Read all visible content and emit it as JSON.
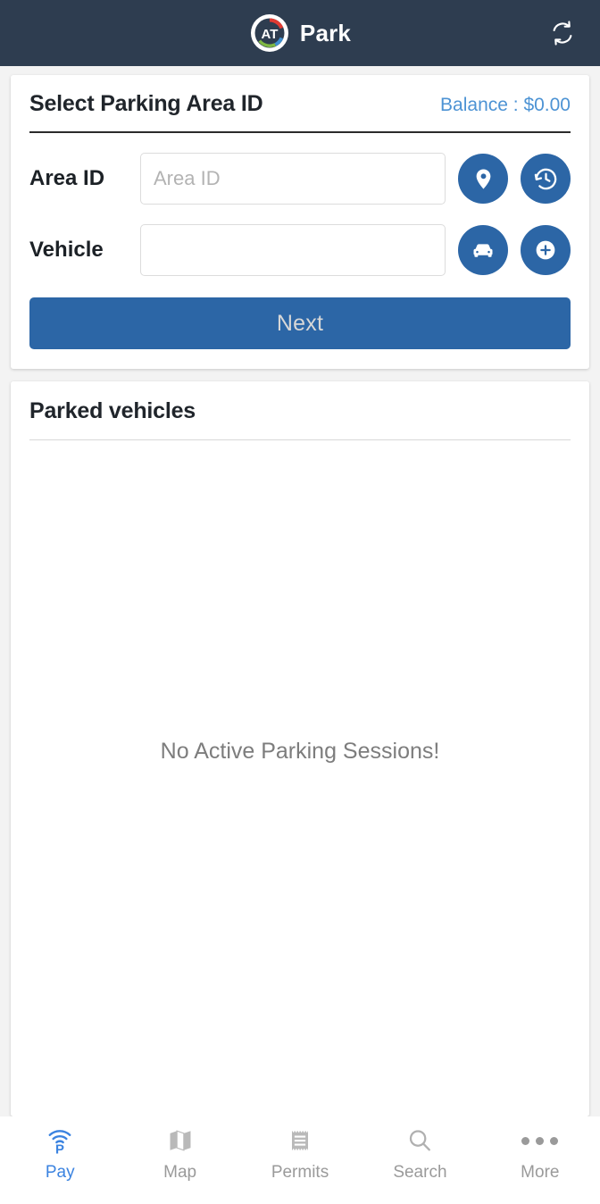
{
  "header": {
    "brand_name": "Park",
    "logo_text": "AT",
    "refresh_icon": "refresh-sync-icon",
    "bg_color": "#2e3d50"
  },
  "select_card": {
    "title": "Select Parking Area ID",
    "balance": "Balance : $0.00",
    "balance_color": "#4d93d4",
    "area": {
      "label": "Area ID",
      "value": "",
      "placeholder": "Area ID",
      "buttons": [
        {
          "name": "map-pin-icon",
          "title": "Find on map"
        },
        {
          "name": "history-clock-icon",
          "title": "Recent areas"
        }
      ]
    },
    "vehicle": {
      "label": "Vehicle",
      "value": "",
      "placeholder": "",
      "buttons": [
        {
          "name": "car-icon",
          "title": "Select vehicle"
        },
        {
          "name": "plus-circle-icon",
          "title": "Add vehicle"
        }
      ]
    },
    "next_label": "Next",
    "accent_color": "#2c66a6"
  },
  "parked_card": {
    "title": "Parked vehicles",
    "empty_message": "No Active Parking Sessions!"
  },
  "tabbar": {
    "items": [
      {
        "label": "Pay",
        "icon": "parking-wifi-icon",
        "active": true
      },
      {
        "label": "Map",
        "icon": "map-fold-icon",
        "active": false
      },
      {
        "label": "Permits",
        "icon": "receipt-icon",
        "active": false
      },
      {
        "label": "Search",
        "icon": "magnifier-icon",
        "active": false
      },
      {
        "label": "More",
        "icon": "ellipsis-icon",
        "active": false
      }
    ],
    "active_color": "#3b83e0",
    "inactive_color": "#9a9a9a"
  }
}
